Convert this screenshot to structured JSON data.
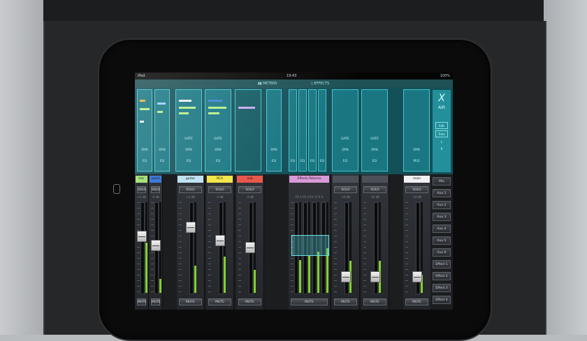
{
  "status_bar": {
    "carrier": "iPad",
    "time": "19:43",
    "battery": "100%"
  },
  "tabs": [
    {
      "label": "METERS"
    },
    {
      "label": "EFFECTS"
    }
  ],
  "overview": {
    "labels": {
      "gate": "GATE",
      "dyn": "DYN",
      "eq": "EQ",
      "fx": "FX",
      "peq": "PEQ"
    }
  },
  "logo": {
    "symbol": "X",
    "text": "AIR"
  },
  "logo_buttons": [
    "Edit",
    "Time",
    "L",
    "R"
  ],
  "channels": [
    {
      "name": "mic stereo",
      "color": "#a7e27a",
      "gain": "+1 dB",
      "solo": "SOLO",
      "mute": "MUTE"
    },
    {
      "name": "vocal",
      "color": "#3d7bd9",
      "gain": "-6 dB",
      "solo": "SOLO",
      "mute": "MUTE"
    },
    {
      "name": "guitar",
      "color": "#bfe3f2",
      "gain": "+3 dB",
      "solo": "SOLO",
      "mute": "MUTE"
    },
    {
      "name": "RCA",
      "color": "#f2e64a",
      "gain": "-2 dB",
      "solo": "SOLO",
      "mute": "MUTE"
    },
    {
      "name": "usb",
      "color": "#e8594a",
      "gain": "-4 dB",
      "solo": "SOLO",
      "mute": "MUTE"
    },
    {
      "name": "Effects Returns",
      "color": "#d99ad8",
      "gain": "FX 1  FX 2  FX 3  FX 4",
      "solo": "",
      "mute": "MUTE"
    },
    {
      "name": "",
      "color": "#4d5057",
      "gain": "-10 dB",
      "solo": "SOLO",
      "mute": "MUTE"
    },
    {
      "name": "",
      "color": "#4d5057",
      "gain": "-10 dB",
      "solo": "SOLO",
      "mute": "MUTE"
    },
    {
      "name": "main",
      "color": "#f1f1f1",
      "gain": "-10 dB",
      "solo": "SOLO",
      "mute": "MUTE"
    }
  ],
  "levels": {
    "fader": [
      0.62,
      0.52,
      0.72,
      0.58,
      0.5,
      0.55,
      0.18,
      0.18,
      0.18
    ],
    "meter": [
      0.55,
      0.15,
      0.3,
      0.4,
      0.25,
      0.45,
      0.35,
      0.35,
      0.2
    ]
  },
  "bus_nav": [
    "Mix",
    "Aux 1",
    "Aux 2",
    "Aux 3",
    "Aux 4",
    "Aux 5",
    "Aux 6",
    "Effect 1",
    "Effect 2",
    "Effect 3",
    "Effect 4"
  ],
  "colors": {
    "accent": "#2fc6d0",
    "screen_bg": "#0f4c55"
  }
}
